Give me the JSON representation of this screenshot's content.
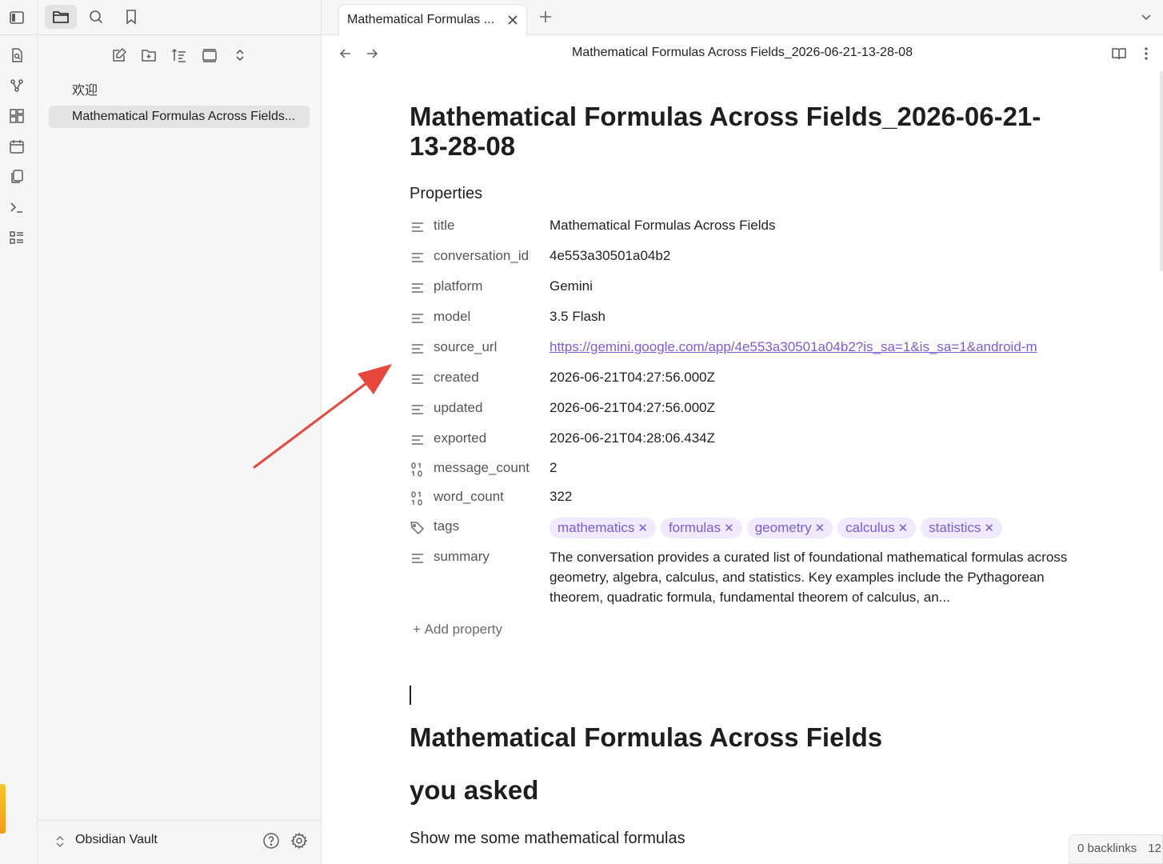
{
  "sidebar": {
    "tree": [
      {
        "label": "欢迎"
      },
      {
        "label": "Mathematical Formulas Across Fields..."
      }
    ],
    "vault_name": "Obsidian Vault"
  },
  "tabs": [
    {
      "label": "Mathematical Formulas ..."
    }
  ],
  "view": {
    "title": "Mathematical Formulas Across Fields_2026-06-21-13-28-08"
  },
  "note": {
    "inline_title": "Mathematical Formulas Across Fields_2026-06-21-13-28-08",
    "properties_heading": "Properties",
    "properties": {
      "title": {
        "key": "title",
        "value": "Mathematical Formulas Across Fields",
        "icon": "text-icon"
      },
      "conversation_id": {
        "key": "conversation_id",
        "value": "4e553a30501a04b2",
        "icon": "text-icon"
      },
      "platform": {
        "key": "platform",
        "value": "Gemini",
        "icon": "text-icon"
      },
      "model": {
        "key": "model",
        "value": "3.5 Flash",
        "icon": "text-icon"
      },
      "source_url": {
        "key": "source_url",
        "value": "https://gemini.google.com/app/4e553a30501a04b2?is_sa=1&is_sa=1&android-m",
        "icon": "text-icon"
      },
      "created": {
        "key": "created",
        "value": "2026-06-21T04:27:56.000Z",
        "icon": "text-icon"
      },
      "updated": {
        "key": "updated",
        "value": "2026-06-21T04:27:56.000Z",
        "icon": "text-icon"
      },
      "exported": {
        "key": "exported",
        "value": "2026-06-21T04:28:06.434Z",
        "icon": "text-icon"
      },
      "message_count": {
        "key": "message_count",
        "value": "2",
        "icon": "number-icon"
      },
      "word_count": {
        "key": "word_count",
        "value": "322",
        "icon": "number-icon"
      },
      "tags": {
        "key": "tags",
        "icon": "tags-icon",
        "values": [
          "mathematics",
          "formulas",
          "geometry",
          "calculus",
          "statistics"
        ]
      },
      "summary": {
        "key": "summary",
        "value": "The conversation provides a curated list of foundational mathematical formulas across geometry, algebra, calculus, and statistics. Key examples include the Pythagorean theorem, quadratic formula, fundamental theorem of calculus, an...",
        "icon": "text-icon"
      }
    },
    "add_property": "Add property",
    "heading1": "Mathematical Formulas Across Fields",
    "heading2": "you asked",
    "paragraph": "Show me some mathematical formulas"
  },
  "statusbar": {
    "backlinks": "0 backlinks",
    "extra": "12"
  },
  "colors": {
    "accent": "#7b5cd6",
    "tag_bg": "#efeafc",
    "arrow": "#e8473b"
  }
}
